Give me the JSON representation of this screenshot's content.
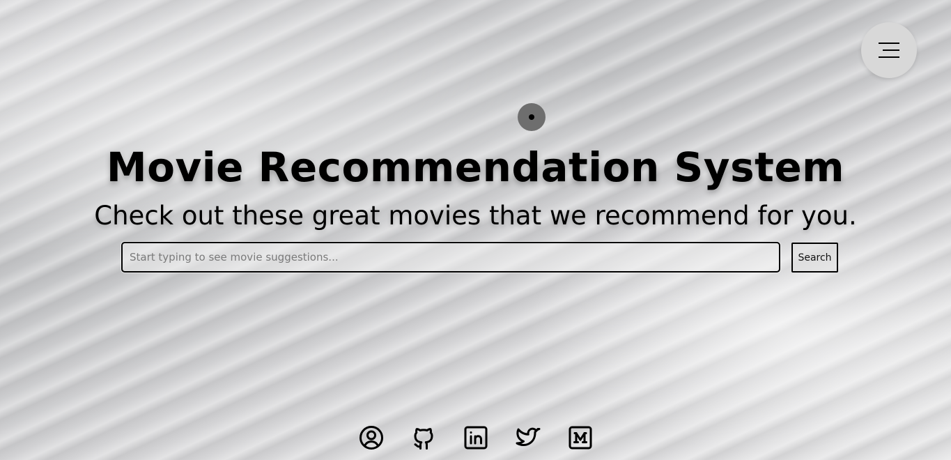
{
  "header": {
    "menu_icon": "hamburger-menu-icon"
  },
  "hero": {
    "indicator_icon": "dot-icon",
    "title": "Movie Recommendation System",
    "subtitle": "Check out these great movies that we recommend for you."
  },
  "search": {
    "placeholder": "Start typing to see movie suggestions...",
    "value": "",
    "button_label": "Search"
  },
  "footer": {
    "social_links": [
      {
        "icon": "user-circle-icon"
      },
      {
        "icon": "github-icon"
      },
      {
        "icon": "linkedin-icon"
      },
      {
        "icon": "twitter-icon"
      },
      {
        "icon": "medium-icon"
      }
    ]
  },
  "colors": {
    "text": "#000000",
    "menu_button_bg": "#d8d8d8",
    "indicator_bg": "#6e6e6e"
  }
}
